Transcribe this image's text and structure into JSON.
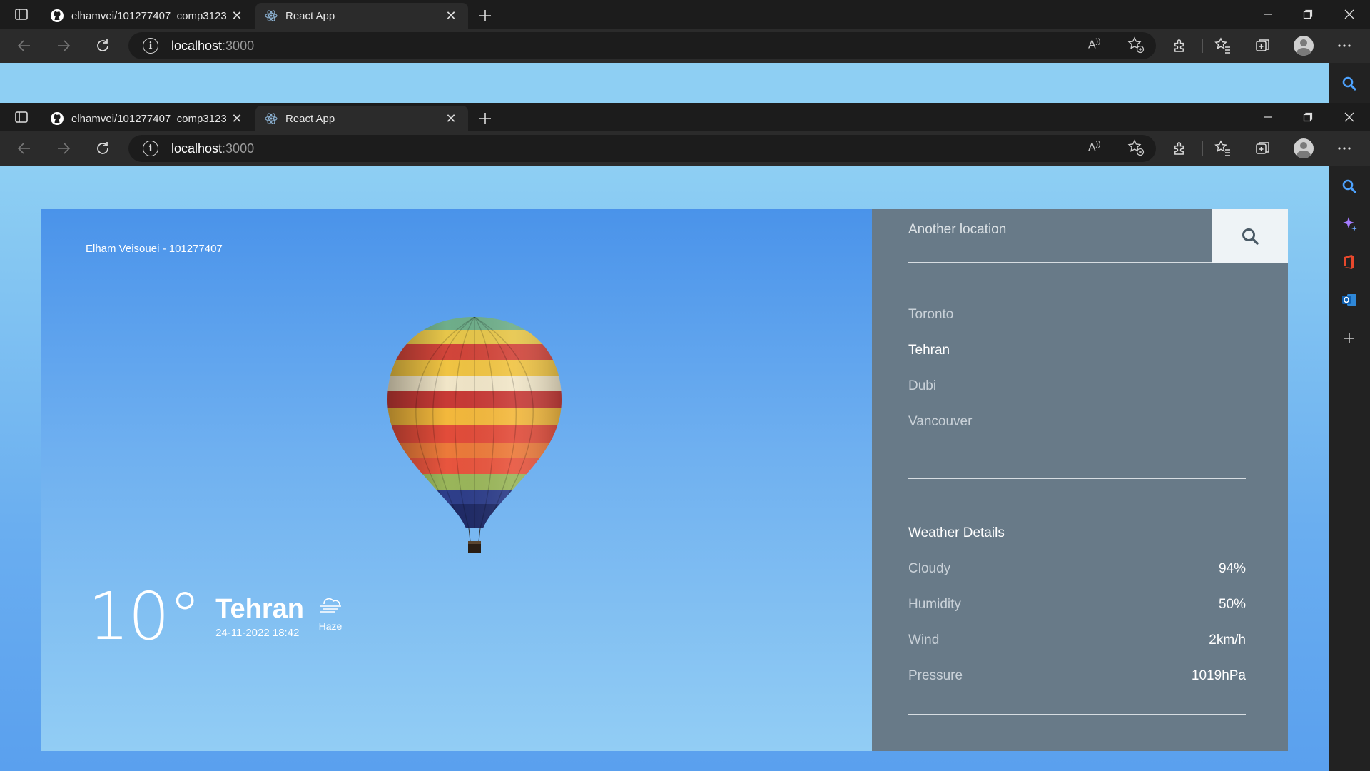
{
  "browser": {
    "tabs": [
      {
        "title": "elhamvei/101277407_comp3123",
        "favicon": "github-icon",
        "active": false
      },
      {
        "title": "React App",
        "favicon": "react-icon",
        "active": true
      }
    ],
    "url_host": "localhost",
    "url_port": ":3000"
  },
  "app": {
    "author": "Elham Veisouei - 101277407",
    "temperature": "10°",
    "city": "Tehran",
    "datetime": "24-11-2022 18:42",
    "condition": "Haze",
    "condition_icon": "haze-icon",
    "search_placeholder": "Another location",
    "locations": [
      "Toronto",
      "Tehran",
      "Dubi",
      "Vancouver"
    ],
    "selected_location": "Tehran",
    "details_title": "Weather Details",
    "details": [
      {
        "label": "Cloudy",
        "value": "94%"
      },
      {
        "label": "Humidity",
        "value": "50%"
      },
      {
        "label": "Wind",
        "value": "2km/h"
      },
      {
        "label": "Pressure",
        "value": "1019hPa"
      }
    ]
  },
  "colors": {
    "panel": "#687a88",
    "sky_top": "#4a93ea",
    "sky_bottom": "#92cdf4",
    "search_button": "#eef3f6"
  }
}
